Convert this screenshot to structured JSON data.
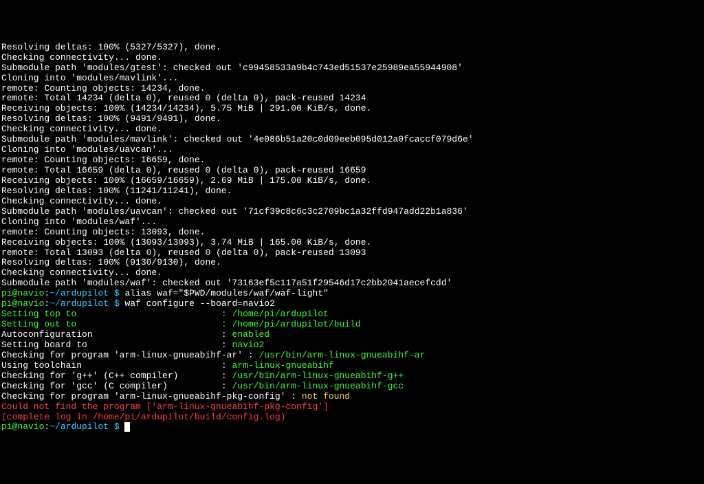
{
  "lines": [
    {
      "segs": [
        {
          "t": "Resolving deltas: 100% (5327/5327), done."
        }
      ]
    },
    {
      "segs": [
        {
          "t": "Checking connectivity... done."
        }
      ]
    },
    {
      "segs": [
        {
          "t": "Submodule path 'modules/gtest': checked out 'c99458533a9b4c743ed51537e25989ea55944908'"
        }
      ]
    },
    {
      "segs": [
        {
          "t": "Cloning into 'modules/mavlink'..."
        }
      ]
    },
    {
      "segs": [
        {
          "t": "remote: Counting objects: 14234, done."
        }
      ]
    },
    {
      "segs": [
        {
          "t": "remote: Total 14234 (delta 0), reused 0 (delta 0), pack-reused 14234"
        }
      ]
    },
    {
      "segs": [
        {
          "t": "Receiving objects: 100% (14234/14234), 5.75 MiB | 291.00 KiB/s, done."
        }
      ]
    },
    {
      "segs": [
        {
          "t": "Resolving deltas: 100% (9491/9491), done."
        }
      ]
    },
    {
      "segs": [
        {
          "t": "Checking connectivity... done."
        }
      ]
    },
    {
      "segs": [
        {
          "t": "Submodule path 'modules/mavlink': checked out '4e086b51a20c0d09eeb095d012a0fcaccf079d6e'"
        }
      ]
    },
    {
      "segs": [
        {
          "t": "Cloning into 'modules/uavcan'..."
        }
      ]
    },
    {
      "segs": [
        {
          "t": "remote: Counting objects: 16659, done."
        }
      ]
    },
    {
      "segs": [
        {
          "t": "remote: Total 16659 (delta 0), reused 0 (delta 0), pack-reused 16659"
        }
      ]
    },
    {
      "segs": [
        {
          "t": "Receiving objects: 100% (16659/16659), 2.69 MiB | 175.00 KiB/s, done."
        }
      ]
    },
    {
      "segs": [
        {
          "t": "Resolving deltas: 100% (11241/11241), done."
        }
      ]
    },
    {
      "segs": [
        {
          "t": "Checking connectivity... done."
        }
      ]
    },
    {
      "segs": [
        {
          "t": "Submodule path 'modules/uavcan': checked out '71cf39c8c6c3c2709bc1a32ffd947add22b1a836'"
        }
      ]
    },
    {
      "segs": [
        {
          "t": "Cloning into 'modules/waf'..."
        }
      ]
    },
    {
      "segs": [
        {
          "t": "remote: Counting objects: 13093, done."
        }
      ]
    },
    {
      "segs": [
        {
          "t": "Receiving objects: 100% (13093/13093), 3.74 MiB | 165.00 KiB/s, done."
        }
      ]
    },
    {
      "segs": [
        {
          "t": "remote: Total 13093 (delta 0), reused 0 (delta 0), pack-reused 13093"
        }
      ]
    },
    {
      "segs": [
        {
          "t": "Resolving deltas: 100% (9130/9130), done."
        }
      ]
    },
    {
      "segs": [
        {
          "t": "Checking connectivity... done."
        }
      ]
    },
    {
      "segs": [
        {
          "t": "Submodule path 'modules/waf': checked out '73163ef5c117a51f29546d17c2bb2041aecefcdd'"
        }
      ]
    },
    {
      "segs": [
        {
          "t": "pi@navio",
          "c": "green"
        },
        {
          "t": ":"
        },
        {
          "t": "~/ardupilot $",
          "c": "cyan"
        },
        {
          "t": " alias waf=\"$PWD/modules/waf/waf-light\""
        }
      ]
    },
    {
      "segs": [
        {
          "t": "pi@navio",
          "c": "green"
        },
        {
          "t": ":"
        },
        {
          "t": "~/ardupilot $",
          "c": "cyan"
        },
        {
          "t": " waf configure --board=navio2"
        }
      ]
    },
    {
      "segs": [
        {
          "t": "Setting top to                           : ",
          "c": "green"
        },
        {
          "t": "/home/pi/ardupilot",
          "c": "green"
        }
      ]
    },
    {
      "segs": [
        {
          "t": "Setting out to                           : ",
          "c": "green"
        },
        {
          "t": "/home/pi/ardupilot/build",
          "c": "green"
        }
      ]
    },
    {
      "segs": [
        {
          "t": "Autoconfiguration                        : "
        },
        {
          "t": "enabled",
          "c": "green"
        }
      ]
    },
    {
      "segs": [
        {
          "t": "Setting board to                         : "
        },
        {
          "t": "navio2",
          "c": "green"
        }
      ]
    },
    {
      "segs": [
        {
          "t": "Checking for program 'arm-linux-gnueabihf-ar' : "
        },
        {
          "t": "/usr/bin/arm-linux-gnueabihf-ar",
          "c": "green"
        }
      ]
    },
    {
      "segs": [
        {
          "t": "Using toolchain                          : "
        },
        {
          "t": "arm-linux-gnueabihf",
          "c": "green"
        }
      ]
    },
    {
      "segs": [
        {
          "t": "Checking for 'g++' (C++ compiler)        : "
        },
        {
          "t": "/usr/bin/arm-linux-gnueabihf-g++",
          "c": "green"
        }
      ]
    },
    {
      "segs": [
        {
          "t": "Checking for 'gcc' (C compiler)          : "
        },
        {
          "t": "/usr/bin/arm-linux-gnueabihf-gcc",
          "c": "green"
        }
      ]
    },
    {
      "segs": [
        {
          "t": "Checking for program 'arm-linux-gnueabihf-pkg-config' : "
        },
        {
          "t": "not found",
          "c": "yellow"
        }
      ]
    },
    {
      "segs": [
        {
          "t": "Could not find the program ['arm-linux-gnueabihf-pkg-config']",
          "c": "red"
        }
      ]
    },
    {
      "segs": [
        {
          "t": "(complete log in /home/pi/ardupilot/build/config.log)",
          "c": "red"
        }
      ]
    },
    {
      "segs": [
        {
          "t": "pi@navio",
          "c": "green"
        },
        {
          "t": ":"
        },
        {
          "t": "~/ardupilot $",
          "c": "cyan"
        },
        {
          "t": " "
        }
      ],
      "cursor": true
    }
  ]
}
